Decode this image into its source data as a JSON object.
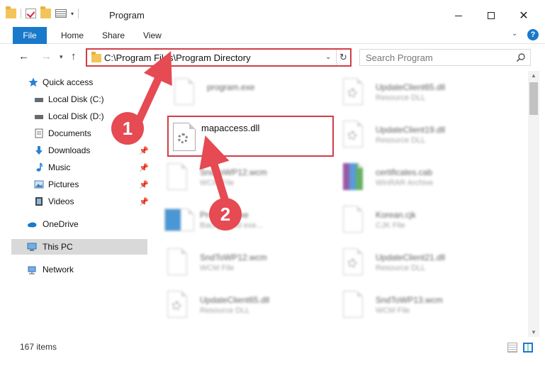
{
  "window": {
    "title": "Program"
  },
  "ribbon": {
    "file_label": "File",
    "tabs": [
      "Home",
      "Share",
      "View"
    ],
    "help_glyph": "?"
  },
  "address": {
    "path": "C:\\Program Files\\Program Directory",
    "search_placeholder": "Search Program"
  },
  "sidebar": {
    "items": [
      {
        "label": "Quick access",
        "icon": "star-icon"
      },
      {
        "label": "Local Disk (C:)",
        "icon": "drive-icon"
      },
      {
        "label": "Local Disk (D:)",
        "icon": "drive-icon"
      },
      {
        "label": "Documents",
        "icon": "documents-icon"
      },
      {
        "label": "Downloads",
        "icon": "download-icon"
      },
      {
        "label": "Music",
        "icon": "music-icon"
      },
      {
        "label": "Pictures",
        "icon": "pictures-icon"
      },
      {
        "label": "Videos",
        "icon": "videos-icon"
      },
      {
        "label": "OneDrive",
        "icon": "cloud-icon"
      },
      {
        "label": "This PC",
        "icon": "computer-icon"
      },
      {
        "label": "Network",
        "icon": "network-icon"
      }
    ]
  },
  "files": {
    "left": [
      {
        "name": "program.exe",
        "type": ""
      },
      {
        "name": "SndToWP12.wcm",
        "type": "WCM File"
      },
      {
        "name": "Program.exe",
        "type": "Background exe..."
      },
      {
        "name": "SndToWP12.wcm",
        "type": "WCM File"
      },
      {
        "name": "UpdateClient65.dll",
        "type": "Resource DLL"
      }
    ],
    "right": [
      {
        "name": "UpdateClient65.dll",
        "type": "Resource DLL"
      },
      {
        "name": "UpdateClient19.dll",
        "type": "Resource DLL"
      },
      {
        "name": "certificates.cab",
        "type": "WinRAR Archive"
      },
      {
        "name": "Korean.cjk",
        "type": "CJK File"
      },
      {
        "name": "UpdateClient21.dll",
        "type": "Resource DLL"
      },
      {
        "name": "SndToWP13.wcm",
        "type": "WCM File"
      }
    ],
    "highlighted": {
      "name": "mapaccess.dll"
    }
  },
  "status": {
    "count": "167 items"
  },
  "annotations": {
    "badge1": "1",
    "badge2": "2"
  },
  "colors": {
    "accent": "#1979ca",
    "highlight_border": "#d33c46",
    "badge_fill": "#e64a52"
  }
}
